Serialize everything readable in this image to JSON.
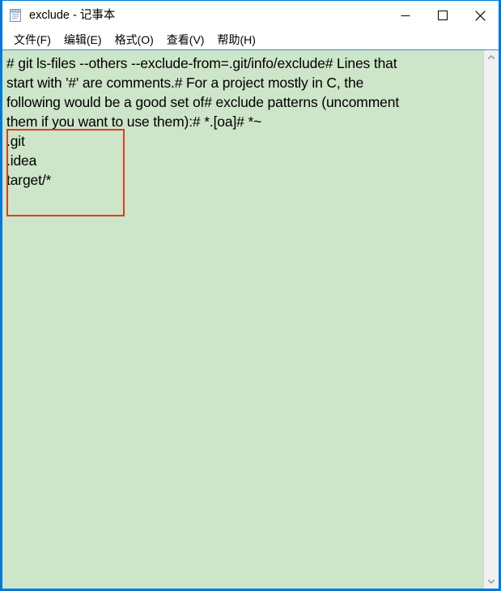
{
  "window": {
    "title": "exclude - 记事本",
    "app_icon": "notepad-icon",
    "border_color": "#0078d7",
    "controls": {
      "minimize_label": "—",
      "maximize_label": "□",
      "close_label": "✕",
      "minimize_name": "minimize-button",
      "maximize_name": "maximize-button",
      "close_name": "close-button"
    }
  },
  "menubar": {
    "items": [
      {
        "label": "文件(F)",
        "name": "menu-file"
      },
      {
        "label": "编辑(E)",
        "name": "menu-edit"
      },
      {
        "label": "格式(O)",
        "name": "menu-format"
      },
      {
        "label": "查看(V)",
        "name": "menu-view"
      },
      {
        "label": "帮助(H)",
        "name": "menu-help"
      }
    ]
  },
  "editor": {
    "background_color": "#cde5c8",
    "text_color": "#000000",
    "paragraph": "# git ls-files --others --exclude-from=.git/info/exclude# Lines that start with '#' are comments.# For a project mostly in C, the following would be a good set of# exclude patterns (uncomment them if you want to use them):# *.[oa]# *~",
    "visual_lines": [
      "# git ls-files --others --exclude-from=.git/info/exclude# Lines that",
      "start with '#' are comments.# For a project mostly in C, the",
      "following would be a good set of# exclude patterns (uncomment",
      "them if you want to use them):# *.[oa]# *~"
    ],
    "pattern_lines": [
      ".git",
      ".idea",
      "target/*"
    ],
    "annotation": {
      "color": "#e03a21",
      "label": "highlight-rectangle"
    }
  },
  "scrollbar": {
    "up_arrow": "▲",
    "down_arrow": "▼",
    "track_color": "#f0f0f0"
  }
}
